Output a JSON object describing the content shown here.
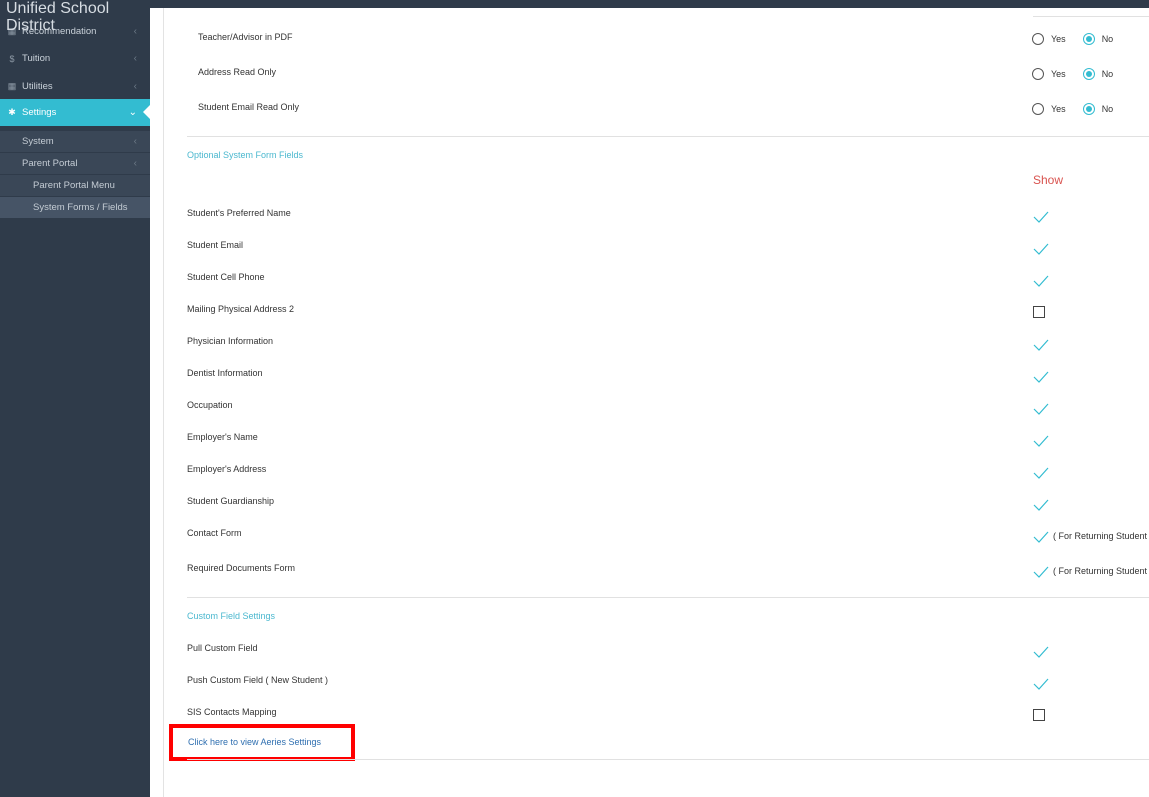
{
  "brand": "Unified School\nDistrict",
  "sidebar": {
    "items": [
      {
        "icon": "grid-icon",
        "label": "Recommendation"
      },
      {
        "icon": "dollar-icon",
        "label": "Tuition"
      },
      {
        "icon": "grid-icon",
        "label": "Utilities"
      },
      {
        "icon": "gear-icon",
        "label": "Settings"
      }
    ],
    "sub": {
      "system": "System",
      "parent_portal": "Parent Portal",
      "parent_portal_menu": "Parent Portal Menu",
      "system_forms": "System Forms / Fields"
    }
  },
  "radios": [
    {
      "label": "Teacher/Advisor in PDF",
      "yes": "Yes",
      "no": "No",
      "selected": "No"
    },
    {
      "label": "Address Read Only",
      "yes": "Yes",
      "no": "No",
      "selected": "No"
    },
    {
      "label": "Student Email Read Only",
      "yes": "Yes",
      "no": "No",
      "selected": "No"
    }
  ],
  "optional_section": {
    "title": "Optional System Form Fields",
    "show_header": "Show",
    "fields": [
      {
        "label": "Student's Preferred Name",
        "checked": true
      },
      {
        "label": "Student Email",
        "checked": true
      },
      {
        "label": "Student Cell Phone",
        "checked": true
      },
      {
        "label": "Mailing Physical Address 2",
        "checked": false
      },
      {
        "label": "Physician Information",
        "checked": true
      },
      {
        "label": "Dentist Information",
        "checked": true
      },
      {
        "label": "Occupation",
        "checked": true
      },
      {
        "label": "Employer's Name",
        "checked": true
      },
      {
        "label": "Employer's Address",
        "checked": true
      },
      {
        "label": "Student Guardianship",
        "checked": true
      },
      {
        "label": "Contact Form",
        "checked": true,
        "note": "( For Returning Student"
      },
      {
        "label": "Required Documents Form",
        "checked": true,
        "note": "( For Returning Student"
      }
    ]
  },
  "custom_section": {
    "title": "Custom Field Settings",
    "fields": [
      {
        "label": "Pull Custom Field",
        "checked": true
      },
      {
        "label": "Push Custom Field ( New Student )",
        "checked": true
      },
      {
        "label": "SIS Contacts Mapping",
        "checked": false
      }
    ]
  },
  "aeries_link": "Click here to view Aeries Settings",
  "colors": {
    "accent": "#33bcd1",
    "sidebar": "#2f3b4a",
    "show": "#d9534f",
    "highlight": "#ff0000"
  }
}
